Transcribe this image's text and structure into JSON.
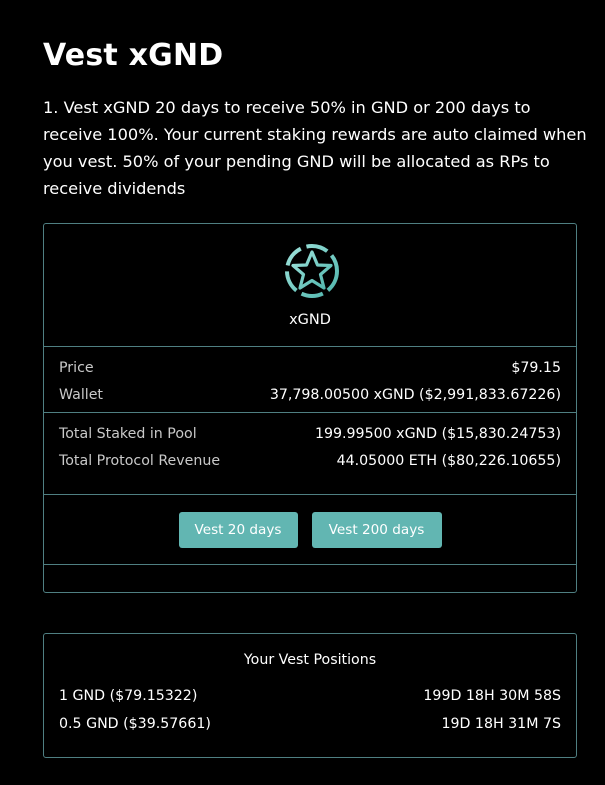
{
  "page": {
    "title": "Vest xGND",
    "intro": "1. Vest xGND 20 days to receive 50% in GND or 200 days to receive 100%. Your current staking rewards are auto claimed when you vest. 50% of your pending GND will be allocated as RPs to receive dividends"
  },
  "token": {
    "name": "xGND",
    "icon": "star-ring-icon",
    "accent_color": "#62b6b2"
  },
  "stats_a": [
    {
      "label": "Price",
      "value": "$79.15"
    },
    {
      "label": "Wallet",
      "value": "37,798.00500 xGND ($2,991,833.67226)"
    }
  ],
  "stats_b": [
    {
      "label": "Total Staked in Pool",
      "value": "199.99500 xGND ($15,830.24753)"
    },
    {
      "label": "Total Protocol Revenue",
      "value": "44.05000 ETH ($80,226.10655)"
    }
  ],
  "buttons": {
    "vest_20": "Vest 20 days",
    "vest_200": "Vest 200 days"
  },
  "positions": {
    "title": "Your Vest Positions",
    "items": [
      {
        "amount": "1 GND ($79.15322)",
        "remaining": "199D 18H 30M 58S"
      },
      {
        "amount": "0.5 GND ($39.57661)",
        "remaining": "19D 18H 31M 7S"
      }
    ]
  }
}
